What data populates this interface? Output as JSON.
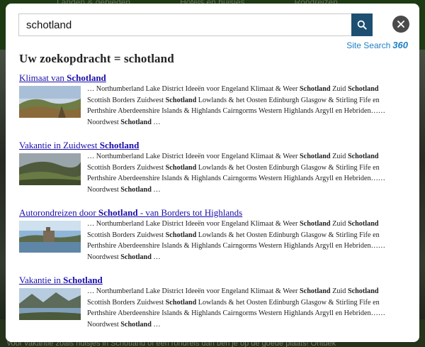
{
  "background": {
    "tabs": [
      "Landen & gebieden",
      "Hotels en huisjes",
      "Rondreizen"
    ],
    "bottom_text": "voor vakantie zoals huisjes in Schotland of een rondreis dan ben je op de goede plaats! Ontdek"
  },
  "search": {
    "value": "schotland",
    "button_icon": "search-icon"
  },
  "close_icon": "close-icon",
  "brand": {
    "label": "Site Search",
    "logo": "360"
  },
  "heading": "Uw zoekopdracht = schotland",
  "results": [
    {
      "title_prefix": "Klimaat van ",
      "title_bold": "Schotland",
      "title_suffix": "",
      "thumbnail": "landscape-hills-sunset"
    },
    {
      "title_prefix": "Vakantie in Zuidwest ",
      "title_bold": "Schotland",
      "title_suffix": "",
      "thumbnail": "landscape-valley-sheep"
    },
    {
      "title_prefix": "Autorondreizen door ",
      "title_bold": "Schotland",
      "title_suffix": " - van Borders tot Highlands",
      "thumbnail": "castle-on-lake"
    },
    {
      "title_prefix": "Vakantie in ",
      "title_bold": "Schotland",
      "title_suffix": "",
      "thumbnail": "loch-mountains"
    }
  ],
  "snippet": {
    "part1": "… Northumberland Lake District Ideeën voor Engeland Klimaat & Weer ",
    "bold1": "Schotland",
    "part2": " Zuid ",
    "bold2": "Schotland",
    "part3": " Scottish Borders Zuidwest ",
    "bold3": "Schotland",
    "part4": " Lowlands & het Oosten Edinburgh Glasgow & Stirling Fife en Perthshire Aberdeenshire Islands & Highlands Cairngorms Western Highlands Argyll en Hebriden…… Noordwest ",
    "bold4": "Schotland",
    "part5": " …"
  }
}
